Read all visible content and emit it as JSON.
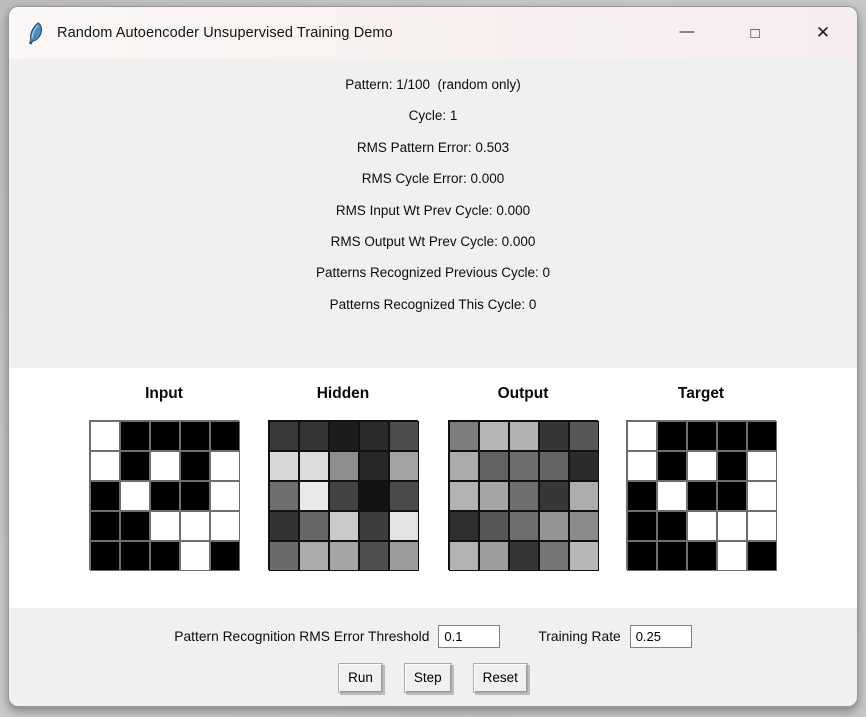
{
  "window": {
    "title": "Random Autoencoder Unsupervised Training Demo",
    "icon": "python-feather-icon",
    "bg_color": "#f0f0f0",
    "titlebar_tint": "#f8f1f0",
    "canvas_bg": "#ffffff"
  },
  "titlebar": {
    "minimize_glyph": "—",
    "maximize_glyph": "□",
    "close_glyph": "✕"
  },
  "status": {
    "lines": [
      "Pattern: 1/100  (random only)",
      "Cycle: 1",
      "RMS Pattern Error: 0.503",
      "RMS Cycle Error: 0.000",
      "RMS Input Wt Prev Cycle: 0.000",
      "RMS Output Wt Prev Cycle: 0.000",
      "Patterns Recognized Previous Cycle: 0",
      "Patterns Recognized This Cycle: 0"
    ]
  },
  "grids": {
    "rows": 5,
    "cols": 5,
    "panels": [
      {
        "id": "input",
        "title": "Input",
        "line_color": "#6e6e6e",
        "cells": [
          "#ffffff",
          "#000000",
          "#000000",
          "#000000",
          "#000000",
          "#ffffff",
          "#000000",
          "#ffffff",
          "#000000",
          "#ffffff",
          "#000000",
          "#ffffff",
          "#000000",
          "#000000",
          "#ffffff",
          "#000000",
          "#000000",
          "#ffffff",
          "#ffffff",
          "#ffffff",
          "#000000",
          "#000000",
          "#000000",
          "#ffffff",
          "#000000"
        ]
      },
      {
        "id": "hidden",
        "title": "Hidden",
        "line_color": "#111111",
        "cells": [
          "#383838",
          "#343434",
          "#1c1c1c",
          "#2b2b2b",
          "#4d4d4d",
          "#d8d8d8",
          "#dbdbdb",
          "#8d8d8d",
          "#262626",
          "#a3a3a3",
          "#6f6f6f",
          "#e9e9e9",
          "#424242",
          "#131313",
          "#4a4a4a",
          "#333333",
          "#666666",
          "#c9c9c9",
          "#3d3d3d",
          "#e3e3e3",
          "#6b6b6b",
          "#ababab",
          "#a6a6a6",
          "#4f4f4f",
          "#9c9c9c"
        ]
      },
      {
        "id": "output",
        "title": "Output",
        "line_color": "#111111",
        "cells": [
          "#7d7d7d",
          "#b5b5b5",
          "#b2b2b2",
          "#353535",
          "#575757",
          "#ababab",
          "#626262",
          "#6d6d6d",
          "#646464",
          "#2b2b2b",
          "#b3b3b3",
          "#a5a5a5",
          "#6f6f6f",
          "#373737",
          "#adadad",
          "#2e2e2e",
          "#575757",
          "#6e6e6e",
          "#949494",
          "#8b8b8b",
          "#b3b3b3",
          "#9e9e9e",
          "#353535",
          "#757575",
          "#b8b8b8"
        ]
      },
      {
        "id": "target",
        "title": "Target",
        "line_color": "#6e6e6e",
        "cells": [
          "#ffffff",
          "#000000",
          "#000000",
          "#000000",
          "#000000",
          "#ffffff",
          "#000000",
          "#ffffff",
          "#000000",
          "#ffffff",
          "#000000",
          "#ffffff",
          "#000000",
          "#000000",
          "#ffffff",
          "#000000",
          "#000000",
          "#ffffff",
          "#ffffff",
          "#ffffff",
          "#000000",
          "#000000",
          "#000000",
          "#ffffff",
          "#000000"
        ]
      }
    ]
  },
  "controls": {
    "threshold_label": "Pattern Recognition RMS Error Threshold",
    "threshold_value": "0.1",
    "rate_label": "Training Rate",
    "rate_value": "0.25",
    "buttons": [
      {
        "label": "Run"
      },
      {
        "label": "Step"
      },
      {
        "label": "Reset"
      }
    ]
  }
}
